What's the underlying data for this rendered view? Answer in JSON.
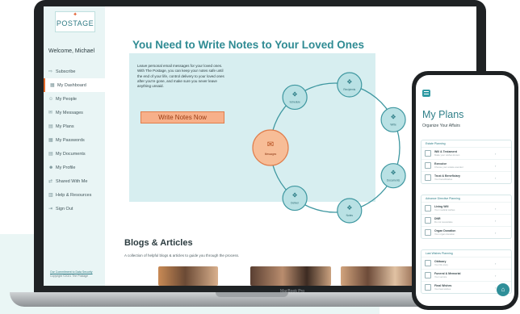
{
  "colors": {
    "teal": "#2f8b93",
    "orange": "#e26a2c",
    "panel": "#d7eef0",
    "sidebar": "#e9f5f5"
  },
  "laptop": {
    "brand": "MacBook Pro"
  },
  "sidebar": {
    "logo_text": "POSTAGE",
    "welcome": "Welcome, Michael",
    "items": [
      {
        "icon": "subscribe-icon",
        "label": "Subscribe",
        "glyph": "⇨"
      },
      {
        "icon": "dashboard-icon",
        "label": "My Dashboard",
        "glyph": "▦"
      },
      {
        "icon": "people-icon",
        "label": "My People",
        "glyph": "☺"
      },
      {
        "icon": "messages-icon",
        "label": "My Messages",
        "glyph": "✉"
      },
      {
        "icon": "plans-icon",
        "label": "My Plans",
        "glyph": "▤"
      },
      {
        "icon": "passwords-icon",
        "label": "My Passwords",
        "glyph": "▦"
      },
      {
        "icon": "documents-icon",
        "label": "My Documents",
        "glyph": "▤"
      },
      {
        "icon": "profile-icon",
        "label": "My Profile",
        "glyph": "☻"
      },
      {
        "icon": "shared-icon",
        "label": "Shared With Me",
        "glyph": "⇄"
      },
      {
        "icon": "help-icon",
        "label": "Help & Resources",
        "glyph": "▥"
      },
      {
        "icon": "signout-icon",
        "label": "Sign Out",
        "glyph": "⇥"
      }
    ],
    "footer_link": "Our Commitment to Data Security",
    "footer_copy": "Copyright ©2021 The Postage"
  },
  "main": {
    "headline": "You Need to Write Notes to Your Loved Ones",
    "intro": "Leave personal email messages for your loved ones. With The Postage, you can keep your notes safe until the end of your life, control delivery to your loved ones after you're gone, and make sure you never leave anything unsaid.",
    "cta": "Write Notes Now",
    "cycle_nodes": [
      "Messages",
      "Schedule",
      "Recipients",
      "Write",
      "Documents",
      "Notes",
      "Deliver"
    ],
    "blogs_title": "Blogs & Articles",
    "blogs_sub": "A collection of helpful blogs & articles to guide you through the process."
  },
  "phone": {
    "title": "My Plans",
    "subtitle": "Organize Your Affairs",
    "home": "⌂",
    "sections": [
      {
        "title": "Estate Planning",
        "rows": [
          {
            "t": "Will & Testament",
            "s": "Make your wishes known"
          },
          {
            "t": "Executor",
            "s": "Choose your estate executor"
          },
          {
            "t": "Trust & Beneficiary",
            "s": "Your beneficiaries"
          }
        ]
      },
      {
        "title": "Advance Directive Planning",
        "rows": [
          {
            "t": "Living Will",
            "s": "Your medical wishes"
          },
          {
            "t": "DNR",
            "s": "Do not resuscitate"
          },
          {
            "t": "Organ Donation",
            "s": "Your organ donation"
          }
        ]
      },
      {
        "title": "Last Wishes Planning",
        "rows": [
          {
            "t": "Obituary",
            "s": "Your life story"
          },
          {
            "t": "Funeral & Memorial",
            "s": "Your service"
          },
          {
            "t": "Final Wishes",
            "s": "Your last wishes"
          }
        ]
      }
    ]
  }
}
